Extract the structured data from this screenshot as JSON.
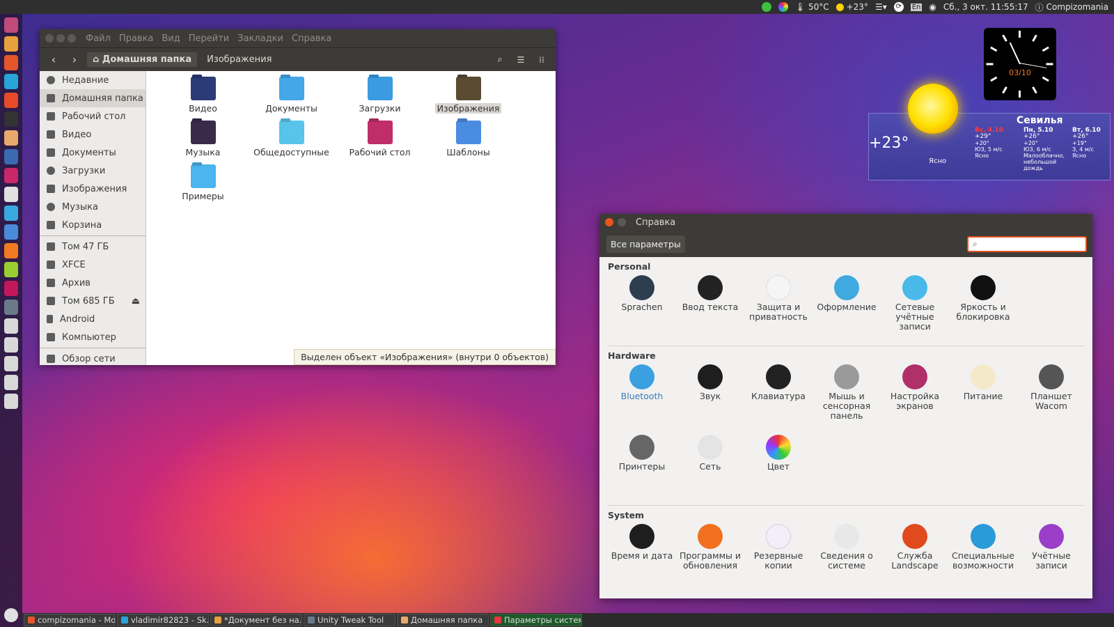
{
  "top_panel": {
    "temp_cpu": "50°C",
    "weather_temp": "+23°",
    "lang": "En",
    "datetime": "Сб., 3 окт. 11:55:17",
    "user": "Compizomania"
  },
  "file_manager": {
    "menu": [
      "Файл",
      "Правка",
      "Вид",
      "Перейти",
      "Закладки",
      "Справка"
    ],
    "breadcrumbs": [
      "Домашняя папка",
      "Изображения"
    ],
    "sidebar": [
      {
        "label": "Недавние",
        "icon": "clock-icon"
      },
      {
        "label": "Домашняя папка",
        "icon": "home-icon"
      },
      {
        "label": "Рабочий стол",
        "icon": "desktop-icon"
      },
      {
        "label": "Видео",
        "icon": "video-icon"
      },
      {
        "label": "Документы",
        "icon": "documents-icon"
      },
      {
        "label": "Загрузки",
        "icon": "download-icon"
      },
      {
        "label": "Изображения",
        "icon": "camera-icon"
      },
      {
        "label": "Музыка",
        "icon": "music-icon"
      },
      {
        "label": "Корзина",
        "icon": "trash-icon"
      }
    ],
    "devices": [
      {
        "label": "Том 47 ГБ",
        "icon": "drive-icon"
      },
      {
        "label": "XFCE",
        "icon": "drive-icon"
      },
      {
        "label": "Архив",
        "icon": "drive-icon"
      },
      {
        "label": "Том 685 ГБ",
        "icon": "drive-icon"
      },
      {
        "label": "Android",
        "icon": "phone-icon"
      },
      {
        "label": "Компьютер",
        "icon": "computer-icon"
      }
    ],
    "network": "Обзор сети",
    "files": [
      {
        "label": "Видео",
        "color": "#2a3b78"
      },
      {
        "label": "Документы",
        "color": "#43a7e8"
      },
      {
        "label": "Загрузки",
        "color": "#3a9be0"
      },
      {
        "label": "Изображения",
        "color": "#5a4b32"
      },
      {
        "label": "Музыка",
        "color": "#3a2a4a"
      },
      {
        "label": "Общедоступные",
        "color": "#58c4ec"
      },
      {
        "label": "Рабочий стол",
        "color": "#c02e6a"
      },
      {
        "label": "Шаблоны",
        "color": "#4a8de0"
      },
      {
        "label": "Примеры",
        "color": "#4cb4ee"
      }
    ],
    "status": "Выделен объект «Изображения» (внутри 0 объектов)"
  },
  "clock": {
    "date": "03/10"
  },
  "weather": {
    "city": "Севилья",
    "current_temp": "+23°",
    "current_desc": "Ясно",
    "forecast": [
      {
        "day": "Вс, 4.10",
        "hi": "+29°",
        "lo": "+20°",
        "wind": "ЮЗ, 5 м/с",
        "desc": "Ясно"
      },
      {
        "day": "Пн, 5.10",
        "hi": "+26°",
        "lo": "+20°",
        "wind": "ЮЗ, 6 м/с",
        "desc": "Малооблачно, небольшой дождь"
      },
      {
        "day": "Вт, 6.10",
        "hi": "+26°",
        "lo": "+19°",
        "wind": "З, 4 м/с",
        "desc": "Ясно"
      }
    ]
  },
  "settings": {
    "title": "Справка",
    "all_button": "Все параметры",
    "sections": [
      {
        "name": "Personal",
        "items": [
          {
            "label": "Sprachen",
            "color": "#2c3e50"
          },
          {
            "label": "Ввод текста",
            "color": "#222"
          },
          {
            "label": "Защита и приватность",
            "color": "#f5f5f5"
          },
          {
            "label": "Оформление",
            "color": "#3fa9e0"
          },
          {
            "label": "Сетевые учётные записи",
            "color": "#48b9e8"
          },
          {
            "label": "Яркость и блокировка",
            "color": "#111"
          }
        ]
      },
      {
        "name": "Hardware",
        "items": [
          {
            "label": "Bluetooth",
            "color": "#3aa0e0"
          },
          {
            "label": "Звук",
            "color": "#1e1e1e"
          },
          {
            "label": "Клавиатура",
            "color": "#222"
          },
          {
            "label": "Мышь и сенсорная панель",
            "color": "#9a9a9a"
          },
          {
            "label": "Настройка экранов",
            "color": "#b0306a"
          },
          {
            "label": "Питание",
            "color": "#f4e9c8"
          },
          {
            "label": "Планшет Wacom",
            "color": "#555"
          },
          {
            "label": "Принтеры",
            "color": "#666"
          },
          {
            "label": "Сеть",
            "color": "#e4e4e4"
          },
          {
            "label": "Цвет",
            "color": "#f7f7f7"
          }
        ]
      },
      {
        "name": "System",
        "items": [
          {
            "label": "Время и дата",
            "color": "#1e1e1e"
          },
          {
            "label": "Программы и обновления",
            "color": "#f07020"
          },
          {
            "label": "Резервные копии",
            "color": "#f3eef8"
          },
          {
            "label": "Сведения о системе",
            "color": "#e8e8e8"
          },
          {
            "label": "Служба Landscape",
            "color": "#e04a1e"
          },
          {
            "label": "Специальные возможности",
            "color": "#2a9ad8"
          },
          {
            "label": "Учётные записи",
            "color": "#9b3ec8"
          }
        ]
      }
    ]
  },
  "taskbar": [
    "compizomania - Mo...",
    "vladimir82823 - Sk...",
    "*Документ без на...",
    "Unity Tweak Tool",
    "Домашняя папка",
    "Параметры системы"
  ]
}
